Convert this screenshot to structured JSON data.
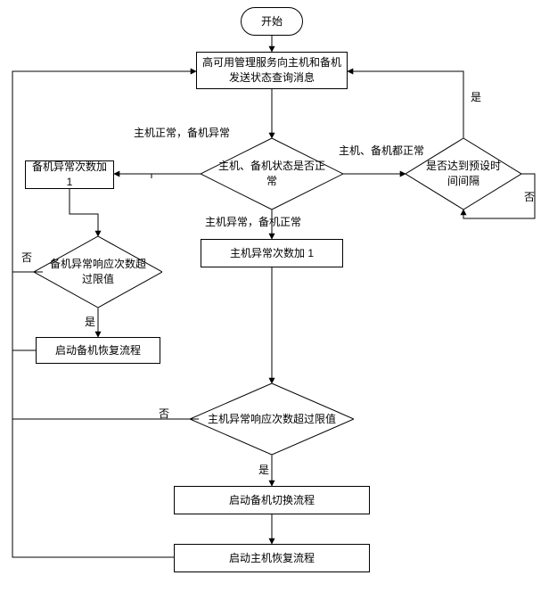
{
  "chart_data": {
    "type": "flowchart",
    "title": "",
    "nodes": [
      {
        "id": "start",
        "type": "terminator",
        "text": "开始"
      },
      {
        "id": "sendQuery",
        "type": "process",
        "text": "高可用管理服务向主机和\n备机发送状态查询消息"
      },
      {
        "id": "statusCheck",
        "type": "decision",
        "text": "主机、备机状\n态是否正常"
      },
      {
        "id": "backupAbnInc",
        "type": "process",
        "text": "备机异常次数加 1"
      },
      {
        "id": "backupLimit",
        "type": "decision",
        "text": "备机异常响应\n次数超过限值"
      },
      {
        "id": "startBackupRecover",
        "type": "process",
        "text": "启动备机恢复流程"
      },
      {
        "id": "intervalCheck",
        "type": "decision",
        "text": "是否达到预\n设时间间隔"
      },
      {
        "id": "primaryAbnInc",
        "type": "process",
        "text": "主机异常次数加 1"
      },
      {
        "id": "primaryLimit",
        "type": "decision",
        "text": "主机异常响应\n次数超过限值"
      },
      {
        "id": "startBackupSwitch",
        "type": "process",
        "text": "启动备机切换流程"
      },
      {
        "id": "startPrimaryRecover",
        "type": "process",
        "text": "启动主机恢复流程"
      }
    ],
    "edges": [
      {
        "from": "start",
        "to": "sendQuery",
        "label": ""
      },
      {
        "from": "sendQuery",
        "to": "statusCheck",
        "label": ""
      },
      {
        "from": "statusCheck",
        "to": "backupAbnInc",
        "label": "主机正常，备机异常"
      },
      {
        "from": "statusCheck",
        "to": "primaryAbnInc",
        "label": "主机异常，备机正常"
      },
      {
        "from": "statusCheck",
        "to": "intervalCheck",
        "label": "主机、备机都正常"
      },
      {
        "from": "intervalCheck",
        "to": "sendQuery",
        "label": "是"
      },
      {
        "from": "intervalCheck",
        "to": "intervalCheck",
        "label": "否"
      },
      {
        "from": "backupAbnInc",
        "to": "backupLimit",
        "label": ""
      },
      {
        "from": "backupLimit",
        "to": "sendQuery",
        "label": "否"
      },
      {
        "from": "backupLimit",
        "to": "startBackupRecover",
        "label": "是"
      },
      {
        "from": "startBackupRecover",
        "to": "sendQuery",
        "label": ""
      },
      {
        "from": "primaryAbnInc",
        "to": "primaryLimit",
        "label": ""
      },
      {
        "from": "primaryLimit",
        "to": "sendQuery",
        "label": "否"
      },
      {
        "from": "primaryLimit",
        "to": "startBackupSwitch",
        "label": "是"
      },
      {
        "from": "startBackupSwitch",
        "to": "startPrimaryRecover",
        "label": ""
      },
      {
        "from": "startPrimaryRecover",
        "to": "sendQuery",
        "label": ""
      }
    ]
  },
  "nodes": {
    "start": "开始",
    "sendQuery": "高可用管理服务向主机和备机发送状态查询消息",
    "statusCheck": "主机、备机状态是否正常",
    "backupAbnInc": "备机异常次数加 1",
    "backupLimit": "备机异常响应次数超过限值",
    "startBackupRecover": "启动备机恢复流程",
    "intervalCheck": "是否达到预设时间间隔",
    "primaryAbnInc": "主机异常次数加 1",
    "primaryLimit": "主机异常响应次数超过限值",
    "startBackupSwitch": "启动备机切换流程",
    "startPrimaryRecover": "启动主机恢复流程"
  },
  "labels": {
    "primaryOkBackupAbn": "主机正常，备机异常",
    "primaryAbnBackupOk": "主机异常，备机正常",
    "bothOk": "主机、备机都正常",
    "yes": "是",
    "no": "否"
  }
}
